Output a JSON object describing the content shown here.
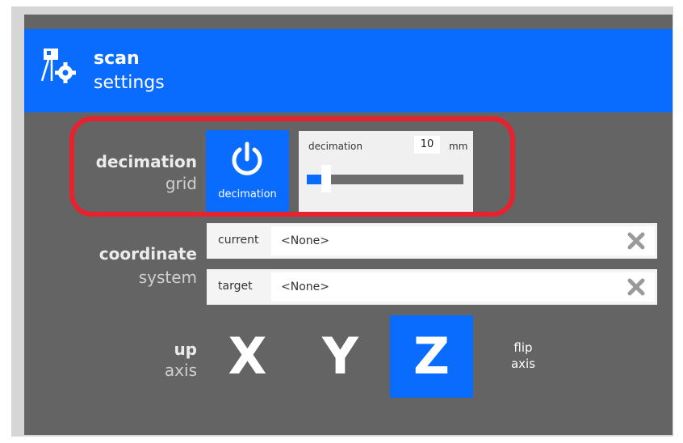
{
  "header": {
    "title": "scan",
    "subtitle": "settings",
    "icon": "scan-settings-icon"
  },
  "decimation": {
    "label_strong": "decimation",
    "label_light": "grid",
    "toggle_caption": "decimation",
    "toggle_icon": "power-icon",
    "slider": {
      "label": "decimation",
      "value": "10",
      "unit": "mm",
      "position_fraction": 0.1
    }
  },
  "coordinate": {
    "label_strong": "coordinate",
    "label_light": "system",
    "current": {
      "key": "current",
      "value": "<None>"
    },
    "target": {
      "key": "target",
      "value": "<None>"
    }
  },
  "up_axis": {
    "label_strong": "up",
    "label_light": "axis",
    "options": [
      "X",
      "Y",
      "Z"
    ],
    "selected": "Z",
    "flip_line1": "flip",
    "flip_line2": "axis"
  },
  "colors": {
    "accent": "#0a6cff",
    "panel": "#646464",
    "highlight": "#e8212e"
  }
}
